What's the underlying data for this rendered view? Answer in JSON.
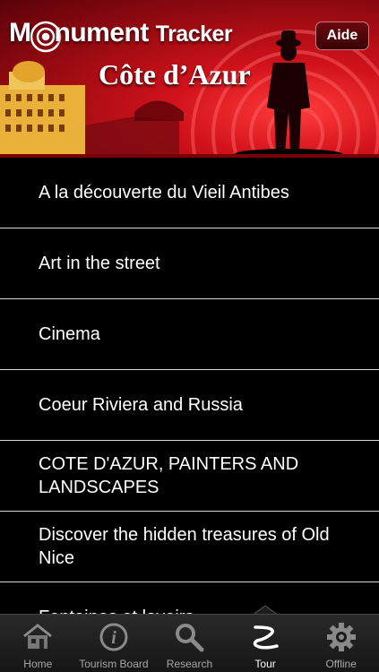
{
  "header": {
    "app_title_first": "M",
    "app_title_rest": "nument",
    "app_title_tracker": "Tracker",
    "region_title": "Côte d’Azur",
    "help_button": "Aide",
    "accent_color": "#d1121b"
  },
  "tours": [
    {
      "label": "A la découverte du Vieil Antibes"
    },
    {
      "label": "Art in the street"
    },
    {
      "label": "Cinema"
    },
    {
      "label": "Coeur Riviera and Russia"
    },
    {
      "label": "COTE D'AZUR, PAINTERS AND LANDSCAPES"
    },
    {
      "label": "Discover the hidden treasures of Old Nice"
    },
    {
      "label": "Fontaines et lavoirs"
    }
  ],
  "tabbar": {
    "active": "Tour",
    "tabs": [
      {
        "label": "Home",
        "icon": "home-icon"
      },
      {
        "label": "Tourism Board",
        "icon": "info-icon"
      },
      {
        "label": "Research",
        "icon": "search-icon"
      },
      {
        "label": "Tour",
        "icon": "tour-path-icon"
      },
      {
        "label": "Offline",
        "icon": "gear-icon"
      }
    ]
  }
}
